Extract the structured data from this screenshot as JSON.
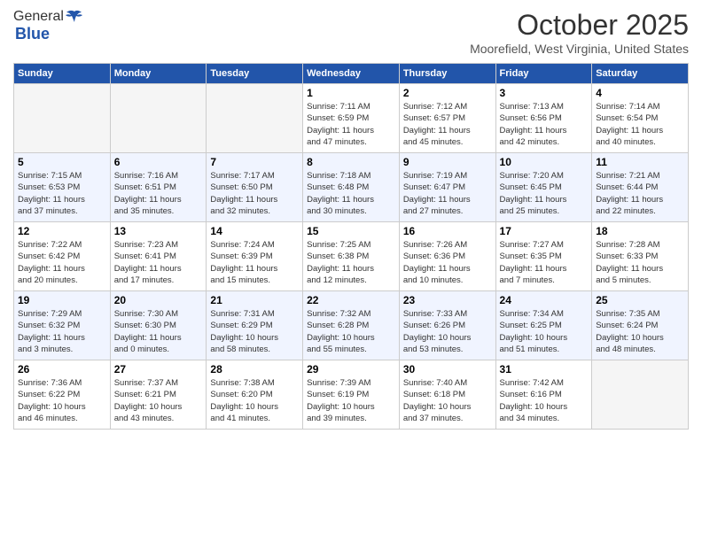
{
  "logo": {
    "general": "General",
    "blue": "Blue"
  },
  "title": "October 2025",
  "subtitle": "Moorefield, West Virginia, United States",
  "weekdays": [
    "Sunday",
    "Monday",
    "Tuesday",
    "Wednesday",
    "Thursday",
    "Friday",
    "Saturday"
  ],
  "weeks": [
    [
      {
        "day": "",
        "info": ""
      },
      {
        "day": "",
        "info": ""
      },
      {
        "day": "",
        "info": ""
      },
      {
        "day": "1",
        "info": "Sunrise: 7:11 AM\nSunset: 6:59 PM\nDaylight: 11 hours\nand 47 minutes."
      },
      {
        "day": "2",
        "info": "Sunrise: 7:12 AM\nSunset: 6:57 PM\nDaylight: 11 hours\nand 45 minutes."
      },
      {
        "day": "3",
        "info": "Sunrise: 7:13 AM\nSunset: 6:56 PM\nDaylight: 11 hours\nand 42 minutes."
      },
      {
        "day": "4",
        "info": "Sunrise: 7:14 AM\nSunset: 6:54 PM\nDaylight: 11 hours\nand 40 minutes."
      }
    ],
    [
      {
        "day": "5",
        "info": "Sunrise: 7:15 AM\nSunset: 6:53 PM\nDaylight: 11 hours\nand 37 minutes."
      },
      {
        "day": "6",
        "info": "Sunrise: 7:16 AM\nSunset: 6:51 PM\nDaylight: 11 hours\nand 35 minutes."
      },
      {
        "day": "7",
        "info": "Sunrise: 7:17 AM\nSunset: 6:50 PM\nDaylight: 11 hours\nand 32 minutes."
      },
      {
        "day": "8",
        "info": "Sunrise: 7:18 AM\nSunset: 6:48 PM\nDaylight: 11 hours\nand 30 minutes."
      },
      {
        "day": "9",
        "info": "Sunrise: 7:19 AM\nSunset: 6:47 PM\nDaylight: 11 hours\nand 27 minutes."
      },
      {
        "day": "10",
        "info": "Sunrise: 7:20 AM\nSunset: 6:45 PM\nDaylight: 11 hours\nand 25 minutes."
      },
      {
        "day": "11",
        "info": "Sunrise: 7:21 AM\nSunset: 6:44 PM\nDaylight: 11 hours\nand 22 minutes."
      }
    ],
    [
      {
        "day": "12",
        "info": "Sunrise: 7:22 AM\nSunset: 6:42 PM\nDaylight: 11 hours\nand 20 minutes."
      },
      {
        "day": "13",
        "info": "Sunrise: 7:23 AM\nSunset: 6:41 PM\nDaylight: 11 hours\nand 17 minutes."
      },
      {
        "day": "14",
        "info": "Sunrise: 7:24 AM\nSunset: 6:39 PM\nDaylight: 11 hours\nand 15 minutes."
      },
      {
        "day": "15",
        "info": "Sunrise: 7:25 AM\nSunset: 6:38 PM\nDaylight: 11 hours\nand 12 minutes."
      },
      {
        "day": "16",
        "info": "Sunrise: 7:26 AM\nSunset: 6:36 PM\nDaylight: 11 hours\nand 10 minutes."
      },
      {
        "day": "17",
        "info": "Sunrise: 7:27 AM\nSunset: 6:35 PM\nDaylight: 11 hours\nand 7 minutes."
      },
      {
        "day": "18",
        "info": "Sunrise: 7:28 AM\nSunset: 6:33 PM\nDaylight: 11 hours\nand 5 minutes."
      }
    ],
    [
      {
        "day": "19",
        "info": "Sunrise: 7:29 AM\nSunset: 6:32 PM\nDaylight: 11 hours\nand 3 minutes."
      },
      {
        "day": "20",
        "info": "Sunrise: 7:30 AM\nSunset: 6:30 PM\nDaylight: 11 hours\nand 0 minutes."
      },
      {
        "day": "21",
        "info": "Sunrise: 7:31 AM\nSunset: 6:29 PM\nDaylight: 10 hours\nand 58 minutes."
      },
      {
        "day": "22",
        "info": "Sunrise: 7:32 AM\nSunset: 6:28 PM\nDaylight: 10 hours\nand 55 minutes."
      },
      {
        "day": "23",
        "info": "Sunrise: 7:33 AM\nSunset: 6:26 PM\nDaylight: 10 hours\nand 53 minutes."
      },
      {
        "day": "24",
        "info": "Sunrise: 7:34 AM\nSunset: 6:25 PM\nDaylight: 10 hours\nand 51 minutes."
      },
      {
        "day": "25",
        "info": "Sunrise: 7:35 AM\nSunset: 6:24 PM\nDaylight: 10 hours\nand 48 minutes."
      }
    ],
    [
      {
        "day": "26",
        "info": "Sunrise: 7:36 AM\nSunset: 6:22 PM\nDaylight: 10 hours\nand 46 minutes."
      },
      {
        "day": "27",
        "info": "Sunrise: 7:37 AM\nSunset: 6:21 PM\nDaylight: 10 hours\nand 43 minutes."
      },
      {
        "day": "28",
        "info": "Sunrise: 7:38 AM\nSunset: 6:20 PM\nDaylight: 10 hours\nand 41 minutes."
      },
      {
        "day": "29",
        "info": "Sunrise: 7:39 AM\nSunset: 6:19 PM\nDaylight: 10 hours\nand 39 minutes."
      },
      {
        "day": "30",
        "info": "Sunrise: 7:40 AM\nSunset: 6:18 PM\nDaylight: 10 hours\nand 37 minutes."
      },
      {
        "day": "31",
        "info": "Sunrise: 7:42 AM\nSunset: 6:16 PM\nDaylight: 10 hours\nand 34 minutes."
      },
      {
        "day": "",
        "info": ""
      }
    ]
  ]
}
